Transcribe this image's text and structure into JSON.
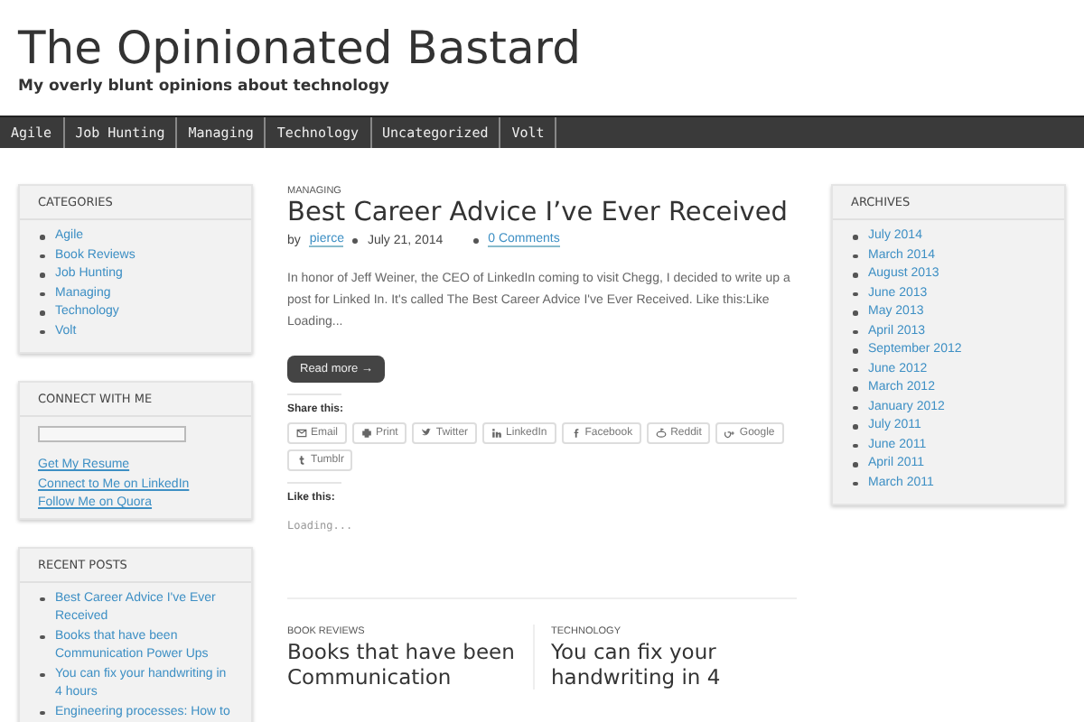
{
  "site": {
    "title": "The Opinionated Bastard",
    "tagline": "My overly blunt opinions about technology"
  },
  "nav": [
    "Agile",
    "Job Hunting",
    "Managing",
    "Technology",
    "Uncategorized",
    "Volt"
  ],
  "categories": {
    "heading": "CATEGORIES",
    "items": [
      "Agile",
      "Book Reviews",
      "Job Hunting",
      "Managing",
      "Technology",
      "Volt"
    ]
  },
  "connect": {
    "heading": "CONNECT WITH ME",
    "links": [
      "Get My Resume",
      "Connect to Me on LinkedIn",
      "Follow Me on Quora"
    ]
  },
  "recent_posts": {
    "heading": "RECENT POSTS",
    "items": [
      "Best Career Advice I've Ever Received",
      "Books that have been Communication Power Ups",
      "You can fix your handwriting in 4 hours",
      "Engineering processes: How to"
    ]
  },
  "post": {
    "category": "MANAGING",
    "title": "Best Career Advice I’ve Ever Received",
    "by": "by",
    "author": "pierce",
    "date": "July 21, 2014",
    "comments": "0 Comments",
    "excerpt": "In honor of Jeff Weiner, the CEO of LinkedIn coming to visit Chegg, I decided to write up a post for Linked In. It's called The Best Career Advice I've Ever Received. Like this:Like Loading...",
    "read_more": "Read more →",
    "share_heading": "Share this:",
    "share_buttons": [
      {
        "kind": "email",
        "label": "Email"
      },
      {
        "kind": "print",
        "label": "Print"
      },
      {
        "kind": "twitter",
        "label": "Twitter"
      },
      {
        "kind": "linkedin",
        "label": "LinkedIn"
      },
      {
        "kind": "facebook",
        "label": "Facebook"
      },
      {
        "kind": "reddit",
        "label": "Reddit"
      },
      {
        "kind": "google",
        "label": "Google"
      },
      {
        "kind": "tumblr",
        "label": "Tumblr"
      }
    ],
    "like_heading": "Like this:",
    "loading": "Loading..."
  },
  "more_posts": [
    {
      "category": "BOOK REVIEWS",
      "title": "Books that have been Communication"
    },
    {
      "category": "TECHNOLOGY",
      "title": "You can fix your handwriting in 4"
    }
  ],
  "archives": {
    "heading": "ARCHIVES",
    "items": [
      "July 2014",
      "March 2014",
      "August 2013",
      "June 2013",
      "May 2013",
      "April 2013",
      "September 2012",
      "June 2012",
      "March 2012",
      "January 2012",
      "July 2011",
      "June 2011",
      "April 2011",
      "March 2011"
    ]
  }
}
